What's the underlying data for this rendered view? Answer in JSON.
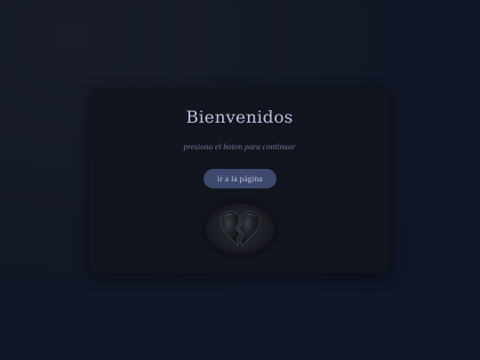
{
  "page": {
    "title": "Bienvenidos",
    "subtitle": "presiona el boton para continuar",
    "button_label": "ir a la página"
  },
  "image": {
    "icon": "broken-heart-icon"
  },
  "colors": {
    "background": "#131826",
    "card": "#12141e",
    "title": "#b8c2de",
    "subtitle": "#6f7893",
    "button_bg": "#3d4a6d",
    "button_text": "#c6cde4"
  }
}
